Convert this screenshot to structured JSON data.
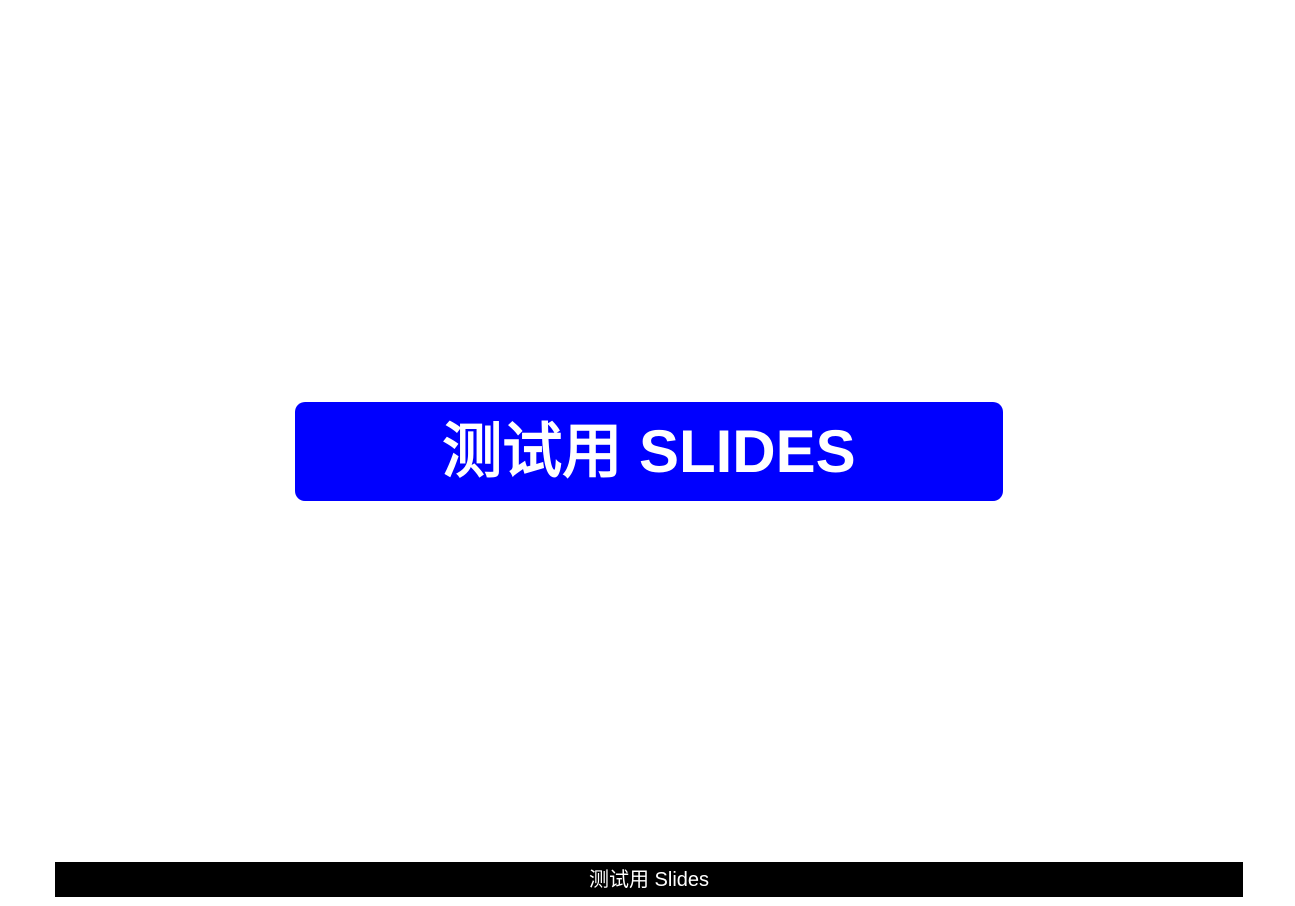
{
  "slide": {
    "title": "测试用 SLIDES",
    "footer": "测试用 Slides"
  },
  "colors": {
    "title_background": "#0000ff",
    "title_text": "#ffffff",
    "footer_background": "#000000",
    "footer_text": "#ffffff",
    "page_background": "#ffffff"
  }
}
